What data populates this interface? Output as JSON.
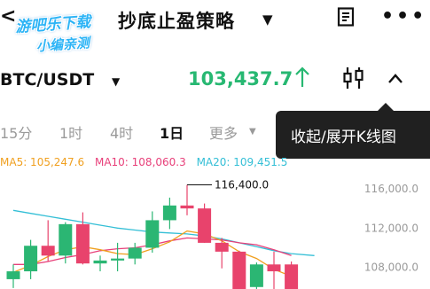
{
  "header": {
    "back_icon": "chevron-left-icon",
    "watermark_line1": "游吧乐下载",
    "watermark_line2": "小编亲测",
    "title": "抄底止盈策略",
    "title_caret": "▼",
    "doc_icon": "document-icon",
    "more_icon": "more-horizontal-icon",
    "more_glyph": "•••"
  },
  "pair": {
    "symbol": "BTC/USDT",
    "caret": "▼",
    "price": "103,437.7",
    "price_color": "#27b872",
    "trend_icon": "arrow-up-icon",
    "candle_icon": "candlestick-icon",
    "collapse_icon": "chevron-up-icon"
  },
  "tabs": [
    {
      "label": "15分",
      "active": false
    },
    {
      "label": "1时",
      "active": false
    },
    {
      "label": "4时",
      "active": false
    },
    {
      "label": "1日",
      "active": true
    },
    {
      "label": "更多",
      "active": false
    }
  ],
  "tabs_more_caret": "▼",
  "tooltip": {
    "text": "收起/展开K线图"
  },
  "ma": {
    "ma5": {
      "label": "MA5: 105,247.6",
      "color": "#f0a020"
    },
    "ma10": {
      "label": "MA10: 108,060.3",
      "color": "#e8407a"
    },
    "ma20": {
      "label": "MA20: 109,451.5",
      "color": "#34bfd6"
    }
  },
  "chart_data": {
    "type": "candlestick",
    "y_ticks": [
      "116,000.0",
      "112,000.0",
      "108,000.0"
    ],
    "y_tick_values": [
      116000,
      112000,
      108000
    ],
    "ylim": [
      105800,
      117800
    ],
    "high_marker": {
      "value": 116400,
      "label": "116,400.0"
    },
    "candles": [
      {
        "o": 106800,
        "h": 108300,
        "l": 105900,
        "c": 107600
      },
      {
        "o": 107600,
        "h": 110800,
        "l": 106800,
        "c": 110200
      },
      {
        "o": 110200,
        "h": 112800,
        "l": 108600,
        "c": 109200
      },
      {
        "o": 109200,
        "h": 112600,
        "l": 108400,
        "c": 112400
      },
      {
        "o": 112400,
        "h": 113600,
        "l": 108300,
        "c": 108400
      },
      {
        "o": 108400,
        "h": 109200,
        "l": 107600,
        "c": 108700
      },
      {
        "o": 108700,
        "h": 110500,
        "l": 107600,
        "c": 108900
      },
      {
        "o": 108900,
        "h": 110500,
        "l": 108300,
        "c": 110000
      },
      {
        "o": 110000,
        "h": 113700,
        "l": 109500,
        "c": 112800
      },
      {
        "o": 112800,
        "h": 115100,
        "l": 111900,
        "c": 114300
      },
      {
        "o": 114300,
        "h": 116400,
        "l": 113300,
        "c": 114000
      },
      {
        "o": 114000,
        "h": 114500,
        "l": 110500,
        "c": 110500
      },
      {
        "o": 110500,
        "h": 111000,
        "l": 107900,
        "c": 109600
      },
      {
        "o": 109600,
        "h": 109700,
        "l": 105800,
        "c": 105800
      },
      {
        "o": 106000,
        "h": 108500,
        "l": 105800,
        "c": 108300
      },
      {
        "o": 108300,
        "h": 109600,
        "l": 105800,
        "c": 107600
      },
      {
        "o": 108300,
        "h": 108600,
        "l": 105800,
        "c": 105800
      }
    ],
    "ma5": [
      107500,
      108200,
      109100,
      109800,
      110100,
      109800,
      109400,
      109300,
      109900,
      110600,
      111700,
      111400,
      110700,
      109600,
      108900,
      107800,
      107100
    ],
    "ma10": [
      108300,
      108300,
      108600,
      109000,
      109300,
      109700,
      109900,
      110000,
      110300,
      110700,
      111000,
      110900,
      110800,
      110500,
      110300,
      109800,
      109200
    ],
    "ma20": [
      113800,
      113500,
      113200,
      112900,
      112600,
      112300,
      112000,
      111800,
      111600,
      111500,
      111400,
      111200,
      110900,
      110500,
      110100,
      109700,
      109400
    ]
  }
}
